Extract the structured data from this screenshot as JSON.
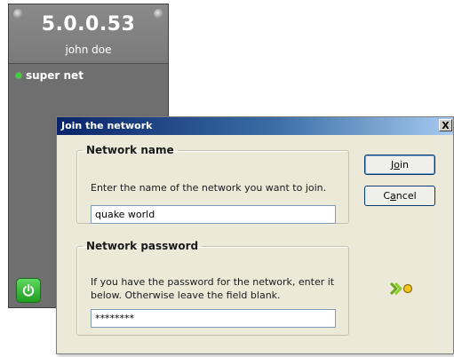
{
  "client": {
    "address": "5.0.0.53",
    "nickname": "john doe",
    "networks": [
      {
        "name": "super net",
        "status": "online"
      }
    ],
    "power_state": "on"
  },
  "dialog": {
    "title": "Join the network",
    "close_label": "X",
    "name_group": {
      "legend": "Network name",
      "description": "Enter the name of the network you want to join.",
      "value": "quake world"
    },
    "password_group": {
      "legend": "Network password",
      "description_line1": "If you have the password for the network, enter it",
      "description_line2": "below. Otherwise leave the field blank.",
      "value": "********"
    },
    "join": {
      "prefix": "J",
      "mnemonic": "o",
      "suffix": "in"
    },
    "cancel": {
      "prefix": "C",
      "mnemonic": "a",
      "suffix": "ncel"
    }
  },
  "colors": {
    "panel": "#6f6f6f",
    "titlebar_start": "#0a246a",
    "online_dot": "#39d439",
    "power_button": "#1f9e1f",
    "dialog_bg": "#ece9d8"
  }
}
